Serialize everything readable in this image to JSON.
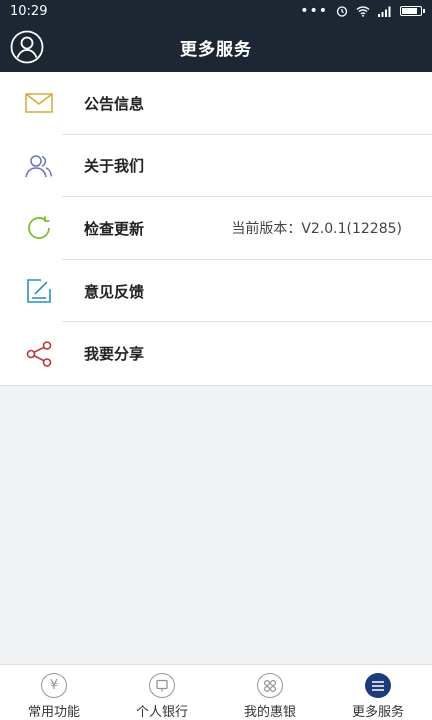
{
  "status_bar": {
    "time": "10:29"
  },
  "header": {
    "title": "更多服务"
  },
  "menu": {
    "items": [
      {
        "label": "公告信息",
        "icon": "mail-icon"
      },
      {
        "label": "关于我们",
        "icon": "users-icon"
      },
      {
        "label": "检查更新",
        "icon": "refresh-icon",
        "value": "当前版本：V2.0.1(12285)"
      },
      {
        "label": "意见反馈",
        "icon": "feedback-icon"
      },
      {
        "label": "我要分享",
        "icon": "share-icon"
      }
    ]
  },
  "tabbar": {
    "items": [
      {
        "label": "常用功能",
        "icon": "yen-icon",
        "active": false
      },
      {
        "label": "个人银行",
        "icon": "personal-bank-icon",
        "active": false
      },
      {
        "label": "我的惠银",
        "icon": "grid-icon",
        "active": false
      },
      {
        "label": "更多服务",
        "icon": "menu-lines-icon",
        "active": true
      }
    ]
  },
  "colors": {
    "header_bg": "#1d2733",
    "accent": "#1c3b78",
    "mail_icon": "#d6a93c",
    "users_icon": "#6a74b8",
    "refresh_icon": "#7cbf2c",
    "feedback_icon": "#2c8fc2",
    "share_icon": "#b6373b"
  }
}
